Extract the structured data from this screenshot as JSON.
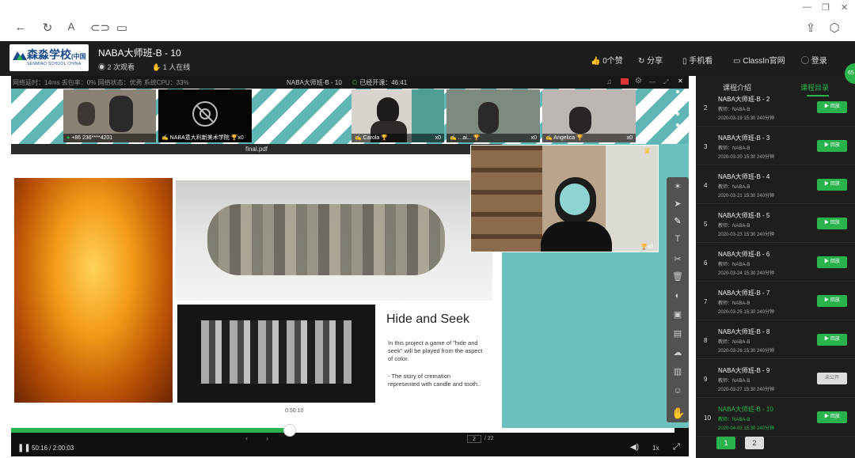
{
  "toolbar": {
    "back_icon": "back-arrow-icon",
    "refresh_icon": "refresh-icon",
    "font_icon": "font-icon",
    "link_icon": "link-icon",
    "window_icon": "window-icon",
    "share_icon": "share-icon",
    "cube_icon": "cube-icon"
  },
  "header": {
    "logo_text": "森淼学校",
    "logo_text_suffix": "中国",
    "logo_sub": "SENMIAO SCHOOL CHINA",
    "title": "NABA大师班-B - 10",
    "views": "2 次观看",
    "online": "1 人在线",
    "likes": "0个赞",
    "share": "分享",
    "mobile": "手机看",
    "classin": "ClassIn官网",
    "login": "登录"
  },
  "status": {
    "text": "网络延时：14ms  丢包率：0%  网络状态：优秀   系统CPU：33%",
    "course": "NABA大师班-B - 10",
    "elapsed": "已经开课：46:41"
  },
  "videos": [
    {
      "label": "+86 236****4201"
    },
    {
      "label": "NABA意大利新美术学院",
      "count": "x0"
    },
    {
      "label": "Carola",
      "count": "x0"
    },
    {
      "label": "...ai...",
      "count": "x0"
    },
    {
      "label": "Angelica",
      "count": "x0"
    }
  ],
  "pdf": {
    "file": "final.pdf",
    "heading": "Hide and Seek",
    "para1": "In this project a game of \"hide and seek\" will be played from the aspect of color.",
    "para2": "- The story of cremation represented with candle and tooth..",
    "timestamp": "0:50:10"
  },
  "player": {
    "time": "50:16 / 2:00:03",
    "page": "2",
    "page_total": "/ 22",
    "speed": "1x",
    "progress": 0.42
  },
  "sidebar": {
    "tab_intro": "课程介绍",
    "tab_catalog": "课程目录",
    "lessons": [
      {
        "num": "2",
        "title": "NABA大师班-B - 2",
        "teacher": "教师：NABA-B",
        "date": "2020-03-19 15:30   240分钟",
        "btn": "回放"
      },
      {
        "num": "3",
        "title": "NABA大师班-B - 3",
        "teacher": "教师：NABA-B",
        "date": "2020-03-20 15:30   240分钟",
        "btn": "回放"
      },
      {
        "num": "4",
        "title": "NABA大师班-B - 4",
        "teacher": "教师：NABA-B",
        "date": "2020-03-21 15:30   240分钟",
        "btn": "回放"
      },
      {
        "num": "5",
        "title": "NABA大师班-B - 5",
        "teacher": "教师：NABA-B",
        "date": "2020-03-23 15:30   240分钟",
        "btn": "回放"
      },
      {
        "num": "6",
        "title": "NABA大师班-B - 6",
        "teacher": "教师：NABA-B",
        "date": "2020-03-24 15:30   240分钟",
        "btn": "回放"
      },
      {
        "num": "7",
        "title": "NABA大师班-B - 7",
        "teacher": "教师：NABA-B",
        "date": "2020-03-25 15:30   240分钟",
        "btn": "回放"
      },
      {
        "num": "8",
        "title": "NABA大师班-B - 8",
        "teacher": "教师：NABA-B",
        "date": "2020-03-26 15:30   240分钟",
        "btn": "回放"
      },
      {
        "num": "9",
        "title": "NABA大师班-B - 9",
        "teacher": "教师：NABA-B",
        "date": "2020-03-27 15:30   240分钟",
        "btn": "未公开"
      },
      {
        "num": "10",
        "title": "NABA大师班-B - 10",
        "teacher": "教师：NABA-B",
        "date": "2020-04-03 15:30   240分钟",
        "btn": "回放"
      }
    ],
    "page1": "1",
    "page2": "2",
    "badge": "65"
  },
  "colors": {
    "accent": "#28b34b",
    "teal": "#6cc1bd",
    "dark": "#1d1d1d"
  }
}
